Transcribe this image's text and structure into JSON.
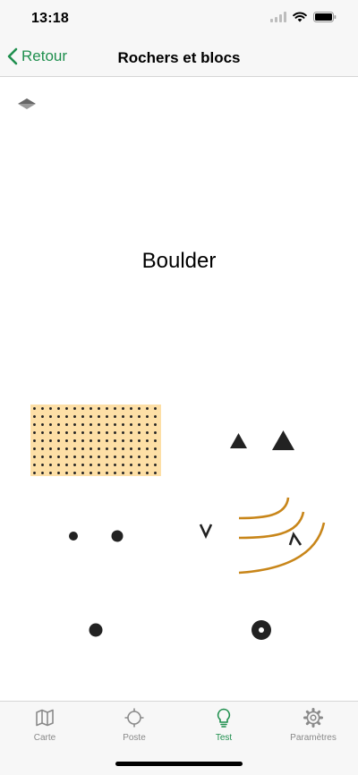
{
  "status": {
    "time": "13:18"
  },
  "nav": {
    "back_label": "Retour",
    "title": "Rochers et blocs"
  },
  "main": {
    "headline": "Boulder"
  },
  "tabs": [
    {
      "label": "Carte",
      "icon": "map-icon",
      "active": false
    },
    {
      "label": "Poste",
      "icon": "crosshair-icon",
      "active": false
    },
    {
      "label": "Test",
      "icon": "lightbulb-icon",
      "active": true
    },
    {
      "label": "Paramètres",
      "icon": "gear-icon",
      "active": false
    }
  ],
  "colors": {
    "accent": "#1f8f4e",
    "contour": "#c8861a",
    "sand_fill": "#fddfa6"
  }
}
